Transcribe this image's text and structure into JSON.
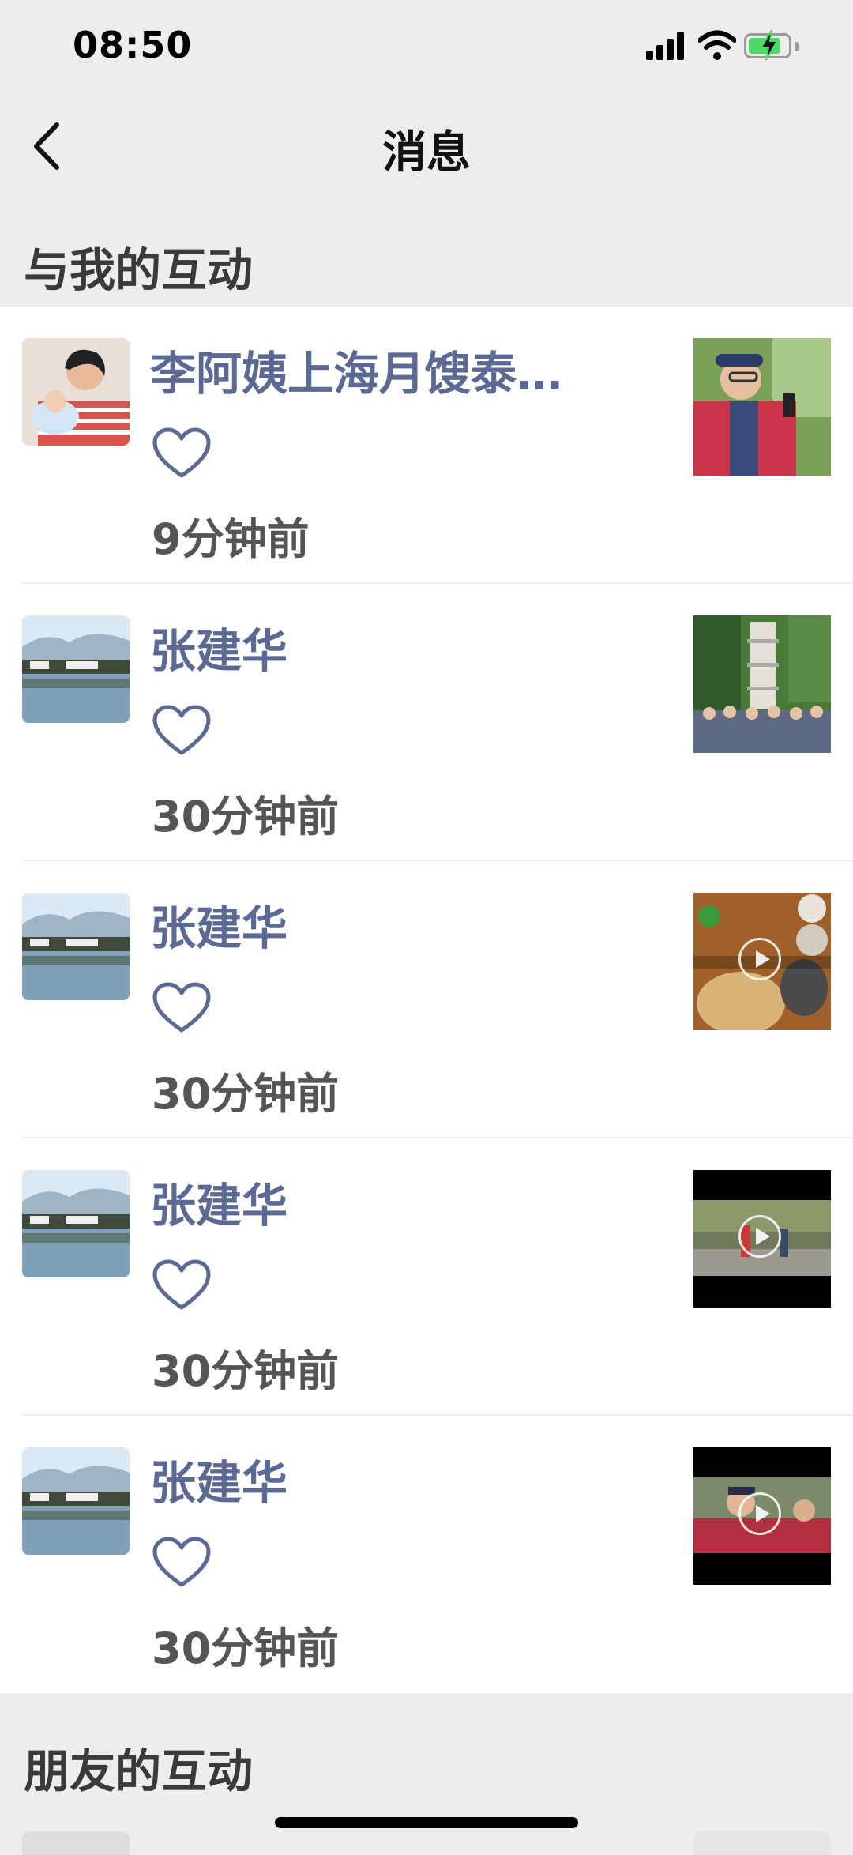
{
  "status_bar": {
    "time": "08:50"
  },
  "nav": {
    "title": "消息"
  },
  "sections": {
    "mine": "与我的互动",
    "friends": "朋友的互动"
  },
  "items": [
    {
      "name": "李阿姨上海月馊泰…",
      "time": "9分钟前"
    },
    {
      "name": "张建华",
      "time": "30分钟前"
    },
    {
      "name": "张建华",
      "time": "30分钟前"
    },
    {
      "name": "张建华",
      "time": "30分钟前"
    },
    {
      "name": "张建华",
      "time": "30分钟前"
    }
  ],
  "colors": {
    "name_link": "#5b6a94",
    "background": "#ededed",
    "battery": "#4cd964"
  }
}
